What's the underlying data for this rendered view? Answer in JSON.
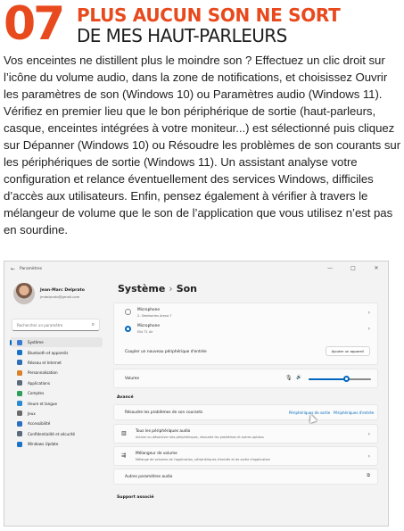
{
  "article": {
    "step_number": "07",
    "headline_line1": "PLUS AUCUN SON NE SORT",
    "headline_line2": "DE MES HAUT-PARLEURS",
    "body": "Vos enceintes ne distillent plus le moindre son ? Effectuez un clic droit sur l’icône du volume audio, dans la zone de notifications, et choisissez Ouvrir les paramètres de son (Windows 10) ou Paramètres audio (Windows 11). Vérifiez en premier lieu que le bon périphérique de sortie (haut-parleurs, casque, enceintes intégrées à votre moniteur...) est sélectionné puis cliquez sur Dépanner (Windows 10) ou Résoudre les problèmes de son courants sur les périphériques de sortie (Windows 11). Un assistant analyse votre configuration et relance éventuellement des services Windows, difficiles d’accès aux utilisateurs. Enfin, pensez également à vérifier à travers le mélangeur de volume que le son de l’application que vous utilisez n’est pas en sourdine."
  },
  "window": {
    "app_title": "Paramètres",
    "controls": [
      "—",
      "□",
      "✕"
    ]
  },
  "profile": {
    "name": "Jean-Marc Delprato",
    "email": "jmdelprato@gmail.com"
  },
  "search": {
    "placeholder": "Rechercher un paramètre"
  },
  "nav": [
    {
      "label": "Système",
      "icon": "monitor-icon",
      "color": "#3a7bd5",
      "active": true
    },
    {
      "label": "Bluetooth et appareils",
      "icon": "bluetooth-icon",
      "color": "#1a73c8",
      "active": false
    },
    {
      "label": "Réseau et Internet",
      "icon": "wifi-icon",
      "color": "#2f6fb7",
      "active": false
    },
    {
      "label": "Personnalisation",
      "icon": "brush-icon",
      "color": "#d9822b",
      "active": false
    },
    {
      "label": "Applications",
      "icon": "apps-icon",
      "color": "#5b6b7b",
      "active": false
    },
    {
      "label": "Comptes",
      "icon": "person-icon",
      "color": "#2e9e5b",
      "active": false
    },
    {
      "label": "Heure et langue",
      "icon": "globe-icon",
      "color": "#2a8bd0",
      "active": false
    },
    {
      "label": "Jeux",
      "icon": "gamepad-icon",
      "color": "#6b6b6b",
      "active": false
    },
    {
      "label": "Accessibilité",
      "icon": "accessibility-icon",
      "color": "#2a6fc0",
      "active": false
    },
    {
      "label": "Confidentialité et sécurité",
      "icon": "shield-icon",
      "color": "#5b6b7b",
      "active": false
    },
    {
      "label": "Windows Update",
      "icon": "update-icon",
      "color": "#1a73c8",
      "active": false
    }
  ],
  "page": {
    "breadcrumb_parent": "Système",
    "breadcrumb_sep": "›",
    "breadcrumb_current": "Son"
  },
  "inputs": {
    "mic1_title": "Microphone",
    "mic1_sub": "2- Steelseries Arena 7",
    "mic2_title": "Microphone",
    "mic2_sub": "Ello T1 Air",
    "pair_label": "Coupler un nouveau périphérique d'entrée",
    "add_device": "Ajouter un appareil"
  },
  "volume": {
    "label": "Volume",
    "level": 0.6
  },
  "advanced": {
    "section": "Avancé",
    "troubleshoot_label": "Résoudre les problèmes de son courants",
    "link_output": "Périphériques de sortie",
    "link_input": "Périphériques d'entrée",
    "all_devices_title": "Tous les périphériques audio",
    "all_devices_sub": "Activer ou désactiver des périphériques, résoudre les problèmes et autres options",
    "mixer_title": "Mélangeur de volume",
    "mixer_sub": "Mélange de volumes de l'application, périphériques d'entrée et de sortie d'application",
    "more_settings": "Autres paramètres audio",
    "support": "Support associé"
  }
}
